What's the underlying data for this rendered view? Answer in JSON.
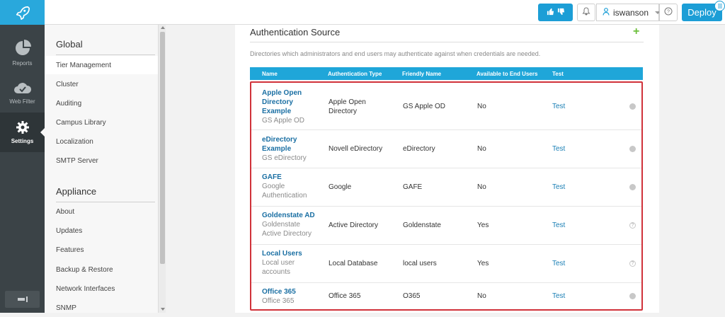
{
  "header": {
    "user_name": "iswanson",
    "deploy_label": "Deploy",
    "colors": {
      "accent": "#1c9ed6",
      "logo_bg": "#29a8dc"
    }
  },
  "main_nav": {
    "items": [
      {
        "label": "Reports",
        "icon": "pie-chart-icon"
      },
      {
        "label": "Web Filter",
        "icon": "cloud-icon"
      },
      {
        "label": "Settings",
        "icon": "gear-icon",
        "active": true
      }
    ]
  },
  "sub_nav": {
    "global_heading": "Global",
    "global_items": [
      "Tier Management",
      "Cluster",
      "Auditing",
      "Campus Library",
      "Localization",
      "SMTP Server"
    ],
    "appliance_heading": "Appliance",
    "appliance_items": [
      "About",
      "Updates",
      "Features",
      "Backup & Restore",
      "Network Interfaces",
      "SNMP"
    ]
  },
  "section": {
    "title": "Authentication Source",
    "description": "Directories which administrators and end users may authenticate against when credentials are needed."
  },
  "table": {
    "columns": [
      "Name",
      "Authentication Type",
      "Friendly Name",
      "Available to End Users",
      "Test"
    ],
    "rows": [
      {
        "name_lines": [
          "Apple Open",
          "Directory",
          "Example"
        ],
        "sub_lines": [
          "GS Apple OD"
        ],
        "type_lines": [
          "Apple Open",
          "Directory"
        ],
        "friendly": "GS Apple OD",
        "available": "No",
        "test": "Test"
      },
      {
        "name_lines": [
          "eDirectory",
          "Example"
        ],
        "sub_lines": [
          "GS eDirectory"
        ],
        "type_lines": [
          "Novell eDirectory"
        ],
        "friendly": "eDirectory",
        "available": "No",
        "test": "Test"
      },
      {
        "name_lines": [
          "GAFE"
        ],
        "sub_lines": [
          "Google",
          "Authentication"
        ],
        "type_lines": [
          "Google"
        ],
        "friendly": "GAFE",
        "available": "No",
        "test": "Test"
      },
      {
        "name_lines": [
          "Goldenstate AD"
        ],
        "sub_lines": [
          "Goldenstate",
          "Active Directory"
        ],
        "type_lines": [
          "Active Directory"
        ],
        "friendly": "Goldenstate",
        "available": "Yes",
        "test": "Test"
      },
      {
        "name_lines": [
          "Local Users"
        ],
        "sub_lines": [
          "Local user",
          "accounts"
        ],
        "type_lines": [
          "Local Database"
        ],
        "friendly": "local users",
        "available": "Yes",
        "test": "Test"
      },
      {
        "name_lines": [
          "Office 365"
        ],
        "sub_lines": [
          "Office 365"
        ],
        "type_lines": [
          "Office 365"
        ],
        "friendly": "O365",
        "available": "No",
        "test": "Test"
      }
    ]
  }
}
